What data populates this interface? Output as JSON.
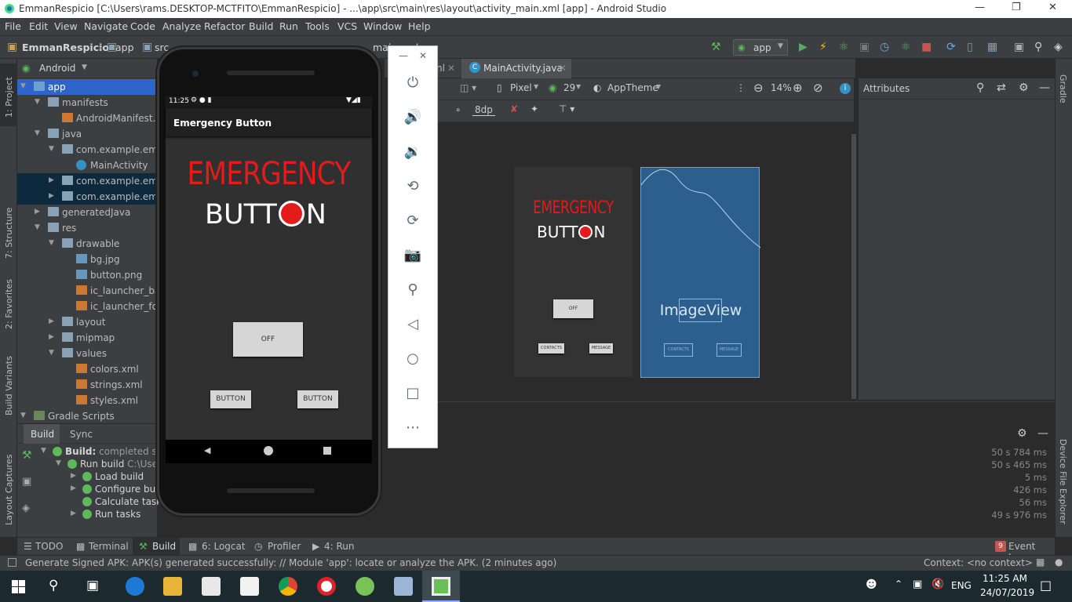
{
  "window": {
    "title": "EmmanRespicio [C:\\Users\\rams.DESKTOP-MCTFITO\\EmmanRespicio] - ...\\app\\src\\main\\res\\layout\\activity_main.xml [app] - Android Studio"
  },
  "menu": [
    "File",
    "Edit",
    "View",
    "Navigate",
    "Code",
    "Analyze",
    "Refactor",
    "Build",
    "Run",
    "Tools",
    "VCS",
    "Window",
    "Help"
  ],
  "nav": {
    "project": "EmmanRespicio",
    "module": "app",
    "src": "src",
    "file_fragment": "main.xml",
    "run_config": "app"
  },
  "left_tabs": {
    "project": "1: Project",
    "structure": "7: Structure",
    "favorites": "2: Favorites",
    "build_variants": "Build Variants",
    "layout_captures": "Layout Captures"
  },
  "right_tabs": {
    "gradle": "Gradle",
    "device_file_explorer": "Device File Explorer"
  },
  "project_panel": {
    "view_mode": "Android",
    "tree": [
      {
        "label": "app",
        "depth": 0,
        "kind": "module",
        "open": true
      },
      {
        "label": "manifests",
        "depth": 1,
        "kind": "folder",
        "open": true
      },
      {
        "label": "AndroidManifest.xml",
        "depth": 2,
        "kind": "xml"
      },
      {
        "label": "java",
        "depth": 1,
        "kind": "folder",
        "open": true
      },
      {
        "label": "com.example.emm",
        "depth": 2,
        "kind": "package",
        "open": true
      },
      {
        "label": "MainActivity",
        "depth": 3,
        "kind": "class"
      },
      {
        "label": "com.example.emm",
        "depth": 2,
        "kind": "package",
        "open": false
      },
      {
        "label": "com.example.emm",
        "depth": 2,
        "kind": "package",
        "open": false
      },
      {
        "label": "generatedJava",
        "depth": 1,
        "kind": "folder",
        "open": false
      },
      {
        "label": "res",
        "depth": 1,
        "kind": "folder",
        "open": true
      },
      {
        "label": "drawable",
        "depth": 2,
        "kind": "folder",
        "open": true
      },
      {
        "label": "bg.jpg",
        "depth": 3,
        "kind": "image"
      },
      {
        "label": "button.png",
        "depth": 3,
        "kind": "image"
      },
      {
        "label": "ic_launcher_bac",
        "depth": 3,
        "kind": "xml"
      },
      {
        "label": "ic_launcher_fore",
        "depth": 3,
        "kind": "xml"
      },
      {
        "label": "layout",
        "depth": 2,
        "kind": "folder",
        "open": false
      },
      {
        "label": "mipmap",
        "depth": 2,
        "kind": "folder",
        "open": false
      },
      {
        "label": "values",
        "depth": 2,
        "kind": "folder",
        "open": true
      },
      {
        "label": "colors.xml",
        "depth": 3,
        "kind": "xml"
      },
      {
        "label": "strings.xml",
        "depth": 3,
        "kind": "xml"
      },
      {
        "label": "styles.xml",
        "depth": 3,
        "kind": "xml"
      },
      {
        "label": "Gradle Scripts",
        "depth": 0,
        "kind": "gradle",
        "open": true
      }
    ]
  },
  "editor": {
    "tab_partial": "nl",
    "tab_active": "MainActivity.java",
    "device": "Pixel",
    "api": "29",
    "theme": "AppTheme",
    "zoom": "14%",
    "margin": "8dp",
    "attributes_label": "Attributes",
    "blueprint_label": "ImageView",
    "preview_emergency": "EMERGENCY",
    "preview_button": "BUTT",
    "preview_button_n": "N",
    "preview_off": "OFF",
    "preview_contacts": "CONTACTS",
    "preview_message": "MESSAGE",
    "bp_contacts": "CONTACTS",
    "bp_message": "MESSAGE"
  },
  "build_panel": {
    "tabs": [
      "Build",
      "Sync"
    ],
    "rows": [
      {
        "label": "Build:",
        "rest": " completed suc",
        "time": "50 s 784 ms",
        "depth": 0
      },
      {
        "label": "Run build",
        "rest": " C:\\Use",
        "time": "50 s 465 ms",
        "depth": 1
      },
      {
        "label": "Load build",
        "rest": "",
        "time": "5 ms",
        "depth": 2
      },
      {
        "label": "Configure bui",
        "rest": "",
        "time": "426 ms",
        "depth": 2
      },
      {
        "label": "Calculate task",
        "rest": "",
        "time": "56 ms",
        "depth": 2
      },
      {
        "label": "Run tasks",
        "rest": "",
        "time": "49 s 976 ms",
        "depth": 2
      }
    ]
  },
  "emulator": {
    "status_time": "11:25",
    "app_title": "Emergency Button",
    "emergency": "EMERGENCY",
    "button_text": "BUTT",
    "button_text_n": "N",
    "off_label": "OFF",
    "button1": "BUTTON",
    "button2": "BUTTON"
  },
  "emulator_controls": [
    "power",
    "volume-up",
    "volume-down",
    "rotate-left",
    "rotate-right",
    "screenshot",
    "zoom",
    "back",
    "home",
    "overview",
    "more"
  ],
  "bottom_tabs": [
    {
      "label": "TODO"
    },
    {
      "label": "Terminal"
    },
    {
      "label": "Build"
    },
    {
      "label": "6: Logcat"
    },
    {
      "label": "Profiler"
    },
    {
      "label": "4: Run"
    }
  ],
  "event_log": "Event Log",
  "event_count": "9",
  "status": {
    "message": "Generate Signed APK: APK(s) generated successfully: // Module 'app': locate or analyze the APK. (2 minutes ago)",
    "context": "Context: <no context>"
  },
  "taskbar": {
    "time": "11:25 AM",
    "date": "24/07/2019",
    "lang": "ENG"
  },
  "colors": {
    "accent": "#2f65ca",
    "emergency_red": "#e31b1b",
    "ide_bg": "#2b2b2b",
    "panel": "#3c3f41",
    "blueprint": "#2c5f8e"
  }
}
